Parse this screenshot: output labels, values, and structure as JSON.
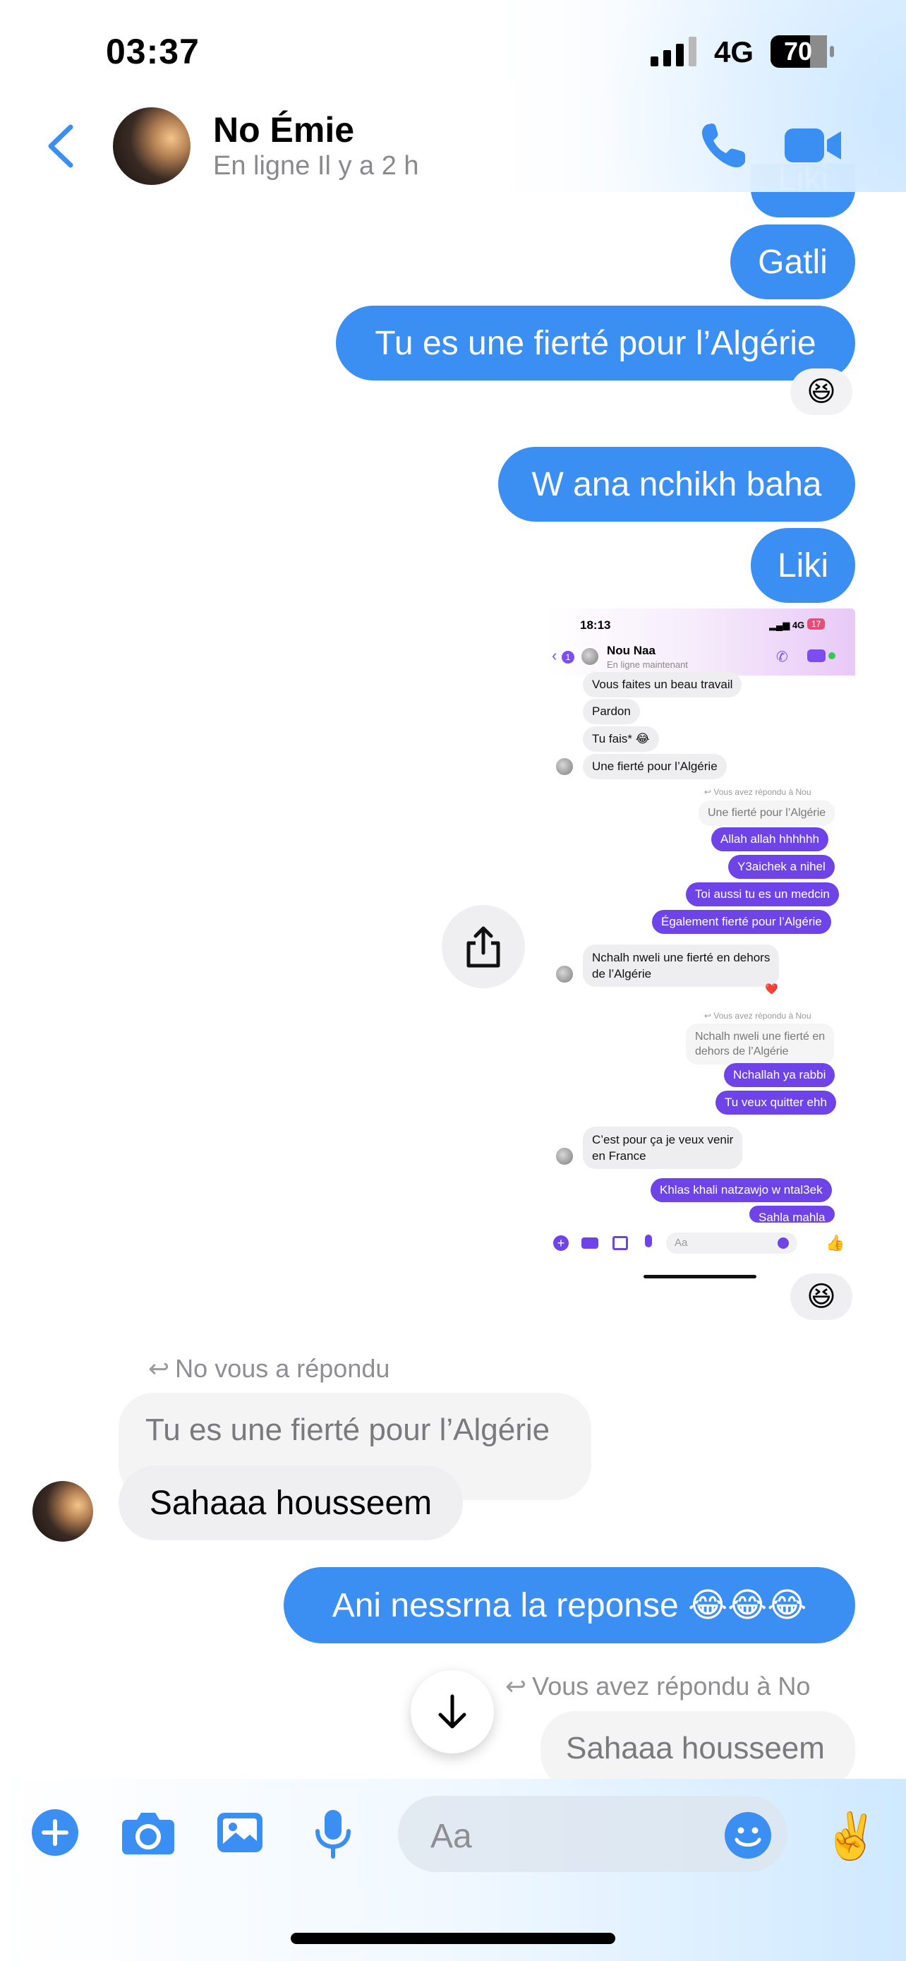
{
  "status_bar": {
    "time": "03:37",
    "network": "4G",
    "battery": "70"
  },
  "header": {
    "back_icon": "chevron-left-icon",
    "contact_name": "No Émie",
    "contact_status": "En ligne Il y a 2 h",
    "call_icon": "phone-icon",
    "video_icon": "video-camera-icon"
  },
  "messages": {
    "partial_top": "Liki",
    "m1": "Gatli",
    "m2": "Tu es une fierté pour l’Algérie",
    "m2_reaction": "😆",
    "m3": "W ana nchikh baha",
    "m4": "Liki",
    "image_reaction": "😆",
    "reply_label_in": "No vous a répondu",
    "quote_in": "Tu es une fierté pour l’Algérie",
    "m5": "Sahaaa housseem",
    "m6": "Ani nessrna la reponse 😂😂😂",
    "reply_label_out": "Vous avez répondu à No",
    "m7": "Sahaaa housseem"
  },
  "shared_image": {
    "time": "18:13",
    "network": "4G",
    "battery": "17",
    "back_badge": "1",
    "name": "Nou Naa",
    "status": "En ligne maintenant",
    "msgs": {
      "a1": "Vous faites un beau travail",
      "a2": "Pardon",
      "a3": "Tu fais* 😂",
      "a4": "Une fierté pour l’Algérie",
      "r1_label": "Vous avez répondu à Nou",
      "r1_quote": "Une fierté pour l’Algérie",
      "b1": "Allah allah hhhhhh",
      "b2": "Y3aichek a nihel",
      "b3": "Toi aussi tu es un medcin",
      "b4": "Également fierté pour l’Algérie",
      "a5_line1": "Nchalh nweli une fierté en dehors",
      "a5_line2": "de l’Algérie",
      "a5_reaction": "❤️",
      "r2_label": "Vous avez répondu à Nou",
      "r2_quote_line1": "Nchalh nweli une fierté en",
      "r2_quote_line2": "dehors de l’Algérie",
      "b5": "Nchallah ya rabbi",
      "b6": "Tu veux quitter ehh",
      "a6_line1": "C’est pour ça je veux venir",
      "a6_line2": "en France",
      "b7": "Khlas khali natzawjo w ntal3ek",
      "b8": "Sahla mahla"
    },
    "input_placeholder": "Aa"
  },
  "composer": {
    "placeholder": "Aa",
    "icons": [
      "plus-icon",
      "camera-icon",
      "image-icon",
      "microphone-icon",
      "emoji-icon"
    ],
    "quick_reaction": "✌️"
  },
  "colors": {
    "accent": "#3b8ef2",
    "incoming": "#efeff1",
    "embedded_accent": "#6e43e8"
  }
}
